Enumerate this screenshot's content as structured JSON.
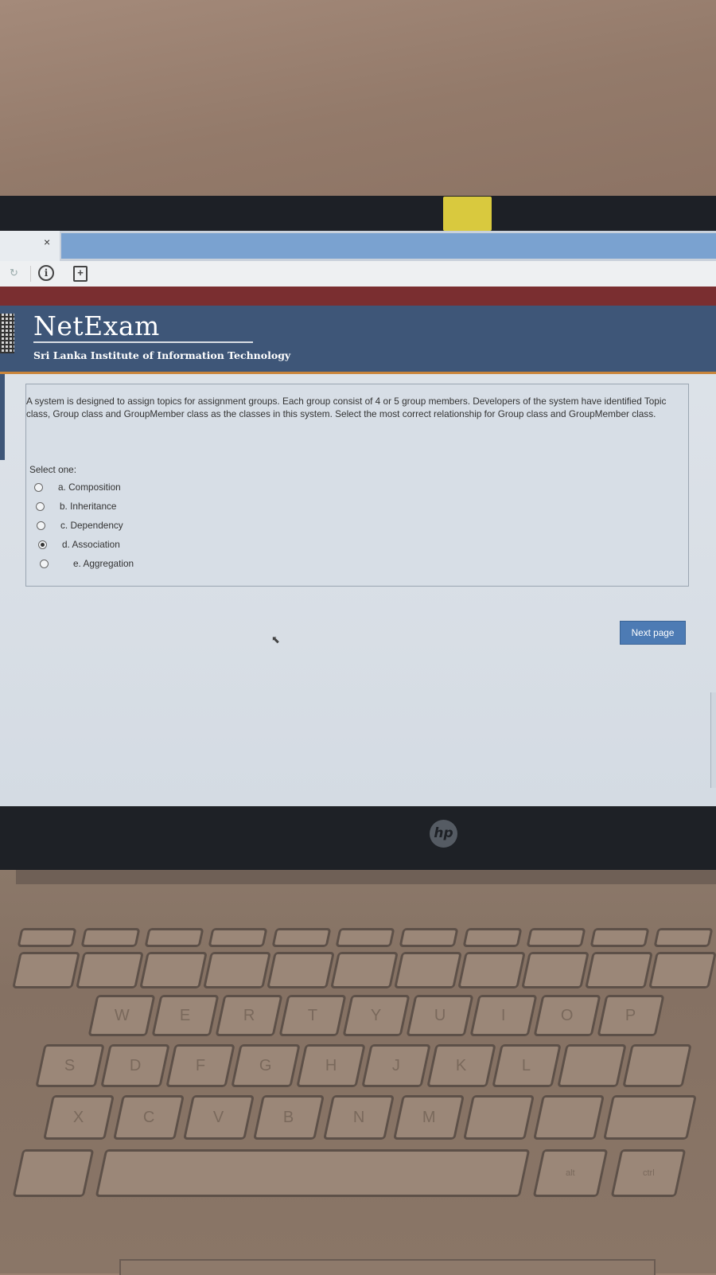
{
  "browser": {
    "tab_close": "×",
    "reload": "↻",
    "info": "i",
    "page_icon": "+"
  },
  "site": {
    "title": "NetExam",
    "subtitle": "Sri Lanka Institute of Information Technology"
  },
  "question": {
    "text": "A system is designed to assign topics for assignment groups. Each group consist of 4 or 5 group members. Developers of the system have identified Topic class, Group class and GroupMember class as the classes in this system. Select the most correct relationship for Group class and GroupMember class.",
    "prompt": "Select one:",
    "options": [
      {
        "label": "a. Composition",
        "selected": false
      },
      {
        "label": "b. Inheritance",
        "selected": false
      },
      {
        "label": "c. Dependency",
        "selected": false
      },
      {
        "label": "d. Association",
        "selected": true
      },
      {
        "label": "e. Aggregation",
        "selected": false
      }
    ]
  },
  "navigation": {
    "next_label": "Next page"
  },
  "laptop": {
    "brand": "hp"
  },
  "keyboard": {
    "row1": [
      "W",
      "E",
      "R",
      "T",
      "Y",
      "U",
      "I",
      "O",
      "P"
    ],
    "row2": [
      "S",
      "D",
      "F",
      "G",
      "H",
      "J",
      "K",
      "L"
    ],
    "row3": [
      "X",
      "C",
      "V",
      "B",
      "N",
      "M"
    ],
    "row4": [
      "alt",
      "ctrl"
    ]
  }
}
